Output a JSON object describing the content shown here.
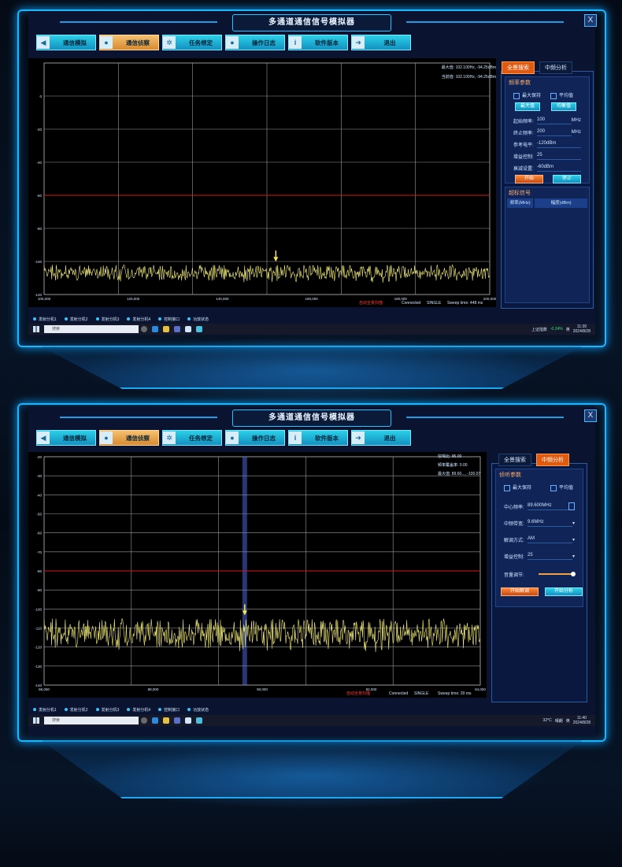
{
  "app_title": "多通道通信信号模拟器",
  "toolbar": [
    {
      "label": "通信模拟",
      "icon": "speaker-icon"
    },
    {
      "label": "通信侦察",
      "icon": "user-icon"
    },
    {
      "label": "任务想定",
      "icon": "gear-icon"
    },
    {
      "label": "操作日志",
      "icon": "user-icon"
    },
    {
      "label": "软件版本",
      "icon": "info-icon"
    },
    {
      "label": "退出",
      "icon": "exit-icon"
    }
  ],
  "close_label": "X",
  "panel1": {
    "active_tool": 1,
    "tabs": [
      "全景搜索",
      "中频分析"
    ],
    "active_tab": 0,
    "params_header": "频率参数",
    "checkbox_max": "最大保持",
    "checkbox_avg": "平均值",
    "btn_max": "最大值",
    "btn_avg": "均衡值",
    "fields": [
      {
        "key": "起始频率:",
        "value": "100",
        "unit": "MHz"
      },
      {
        "key": "终止频率:",
        "value": "200",
        "unit": "MHz"
      },
      {
        "key": "参考电平:",
        "value": "-120dBm",
        "unit": ""
      },
      {
        "key": "增益控制:",
        "value": "25",
        "unit": ""
      },
      {
        "key": "衰减设置:",
        "value": "-60dBm",
        "unit": ""
      }
    ],
    "btn_start": "开始",
    "btn_stop": "停止",
    "signal_header": "超标信号",
    "signal_cols": [
      "频率(MHz)",
      "幅度(dBm)"
    ],
    "chart_note1": "最大值: 102.100Hz, -94.25dBm",
    "chart_note2": "当前值: 102.100Hz, -94.25dBm",
    "status_red": "自动全景扫描",
    "status_connected": "Connected",
    "status_single": "SINGLE",
    "status_sweep": "Sweep time: 448 ms",
    "clock_time": "11:39",
    "clock_date": "2024/8/28",
    "tray_stock": "上证指数",
    "tray_change": "-0.24%",
    "tray_lang": "英"
  },
  "panel2": {
    "active_tool": 1,
    "tabs": [
      "全景搜索",
      "中频分析"
    ],
    "active_tab": 1,
    "params_header": "侦听参数",
    "checkbox_max": "最大保持",
    "checkbox_avg": "平均值",
    "fields": [
      {
        "key": "中心频率:",
        "value": "89.600MHz"
      },
      {
        "key": "中频带宽:",
        "value": "9.6MHz"
      },
      {
        "key": "解调方式:",
        "value": "AM"
      },
      {
        "key": "增益控制:",
        "value": "25"
      }
    ],
    "volume_label": "音量调节:",
    "volume_level": 0.95,
    "btn_start": "开始解调",
    "btn_stop": "开始分析",
    "chart_note1": "信噪比: 95.00",
    "chart_note2": "频率覆盖率: 0.00",
    "chart_note3": "最大值: 89.60..., -100.07",
    "status_red": "自动全景扫描",
    "status_connected": "Connected",
    "status_single": "SINGLE",
    "status_sweep": "Sweep time: 20 ms",
    "clock_time": "11:40",
    "clock_date": "2024/8/28",
    "tray_temp": "32°C",
    "tray_weather": "晴朗",
    "tray_lang": "英"
  },
  "legend": [
    "发射分机1",
    "发射分机2",
    "发射分机3",
    "发射分机4",
    "控制接口",
    "功放状态"
  ],
  "search_placeholder": "搜索",
  "chart_data": [
    {
      "type": "line",
      "x_ticks": [
        "100,000",
        "120,000",
        "140,000",
        "160,000",
        "180,000",
        "200,000"
      ],
      "y_ticks": [
        "0",
        "-20",
        "-40",
        "-60",
        "-80",
        "-100",
        "-120"
      ],
      "ylim": [
        -120,
        20
      ],
      "threshold": -60,
      "noise_floor": [
        -110,
        -102
      ],
      "marker_x": 152.0
    },
    {
      "type": "line",
      "x_ticks": [
        "86,000",
        "88,000",
        "90,000",
        "92,000",
        "94,000"
      ],
      "y_ticks": [
        "-20",
        "-30",
        "-40",
        "-50",
        "-60",
        "-70",
        "-80",
        "-90",
        "-100",
        "-110",
        "-120",
        "-130",
        "-140"
      ],
      "ylim": [
        -140,
        -20
      ],
      "threshold": -80,
      "noise_floor": [
        -118,
        -105
      ],
      "marker_x": 89.6
    }
  ],
  "colors": {
    "accent": "#18b8ff",
    "trace": "#f2ec7a",
    "threshold": "#d01818",
    "active": "#e05a10"
  }
}
